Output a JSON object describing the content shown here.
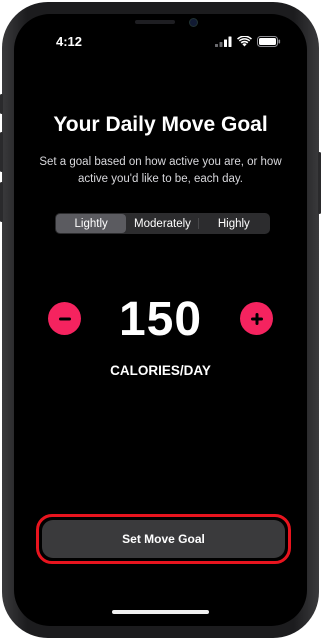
{
  "status_bar": {
    "time": "4:12",
    "icons": [
      "cellular-signal-icon",
      "wifi-icon",
      "battery-icon"
    ]
  },
  "header": {
    "title": "Your Daily Move Goal",
    "subtitle": "Set a goal based on how active you are, or how active you'd like to be, each day."
  },
  "activity_level": {
    "options": [
      "Lightly",
      "Moderately",
      "Highly"
    ],
    "selected": "Lightly"
  },
  "goal": {
    "value": "150",
    "unit": "CALORIES/DAY",
    "decrement_icon": "minus-icon",
    "increment_icon": "plus-icon"
  },
  "actions": {
    "set_goal_label": "Set Move Goal"
  },
  "colors": {
    "accent": "#f5235f",
    "highlight": "#e8141e",
    "background": "#000000",
    "button": "#3a3a3c"
  }
}
